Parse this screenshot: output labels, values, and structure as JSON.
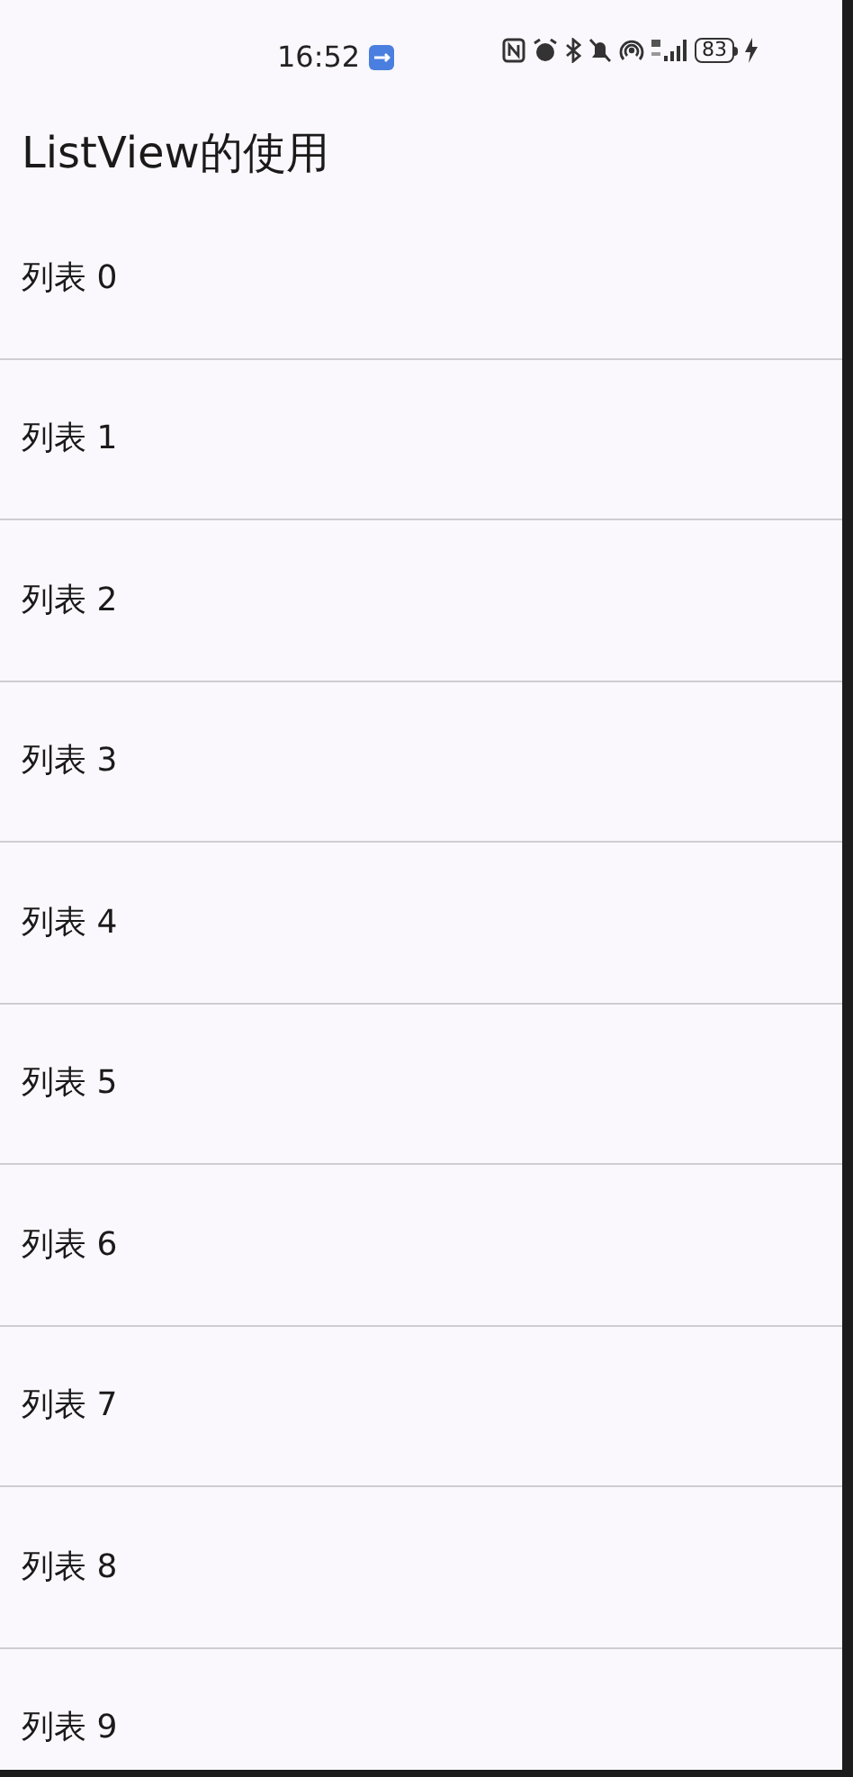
{
  "status_bar": {
    "time": "16:52",
    "battery": "83"
  },
  "app_bar": {
    "title": "ListView的使用"
  },
  "list": [
    {
      "label": "列表 0"
    },
    {
      "label": "列表 1"
    },
    {
      "label": "列表 2"
    },
    {
      "label": "列表 3"
    },
    {
      "label": "列表 4"
    },
    {
      "label": "列表 5"
    },
    {
      "label": "列表 6"
    },
    {
      "label": "列表 7"
    },
    {
      "label": "列表 8"
    },
    {
      "label": "列表 9"
    }
  ]
}
